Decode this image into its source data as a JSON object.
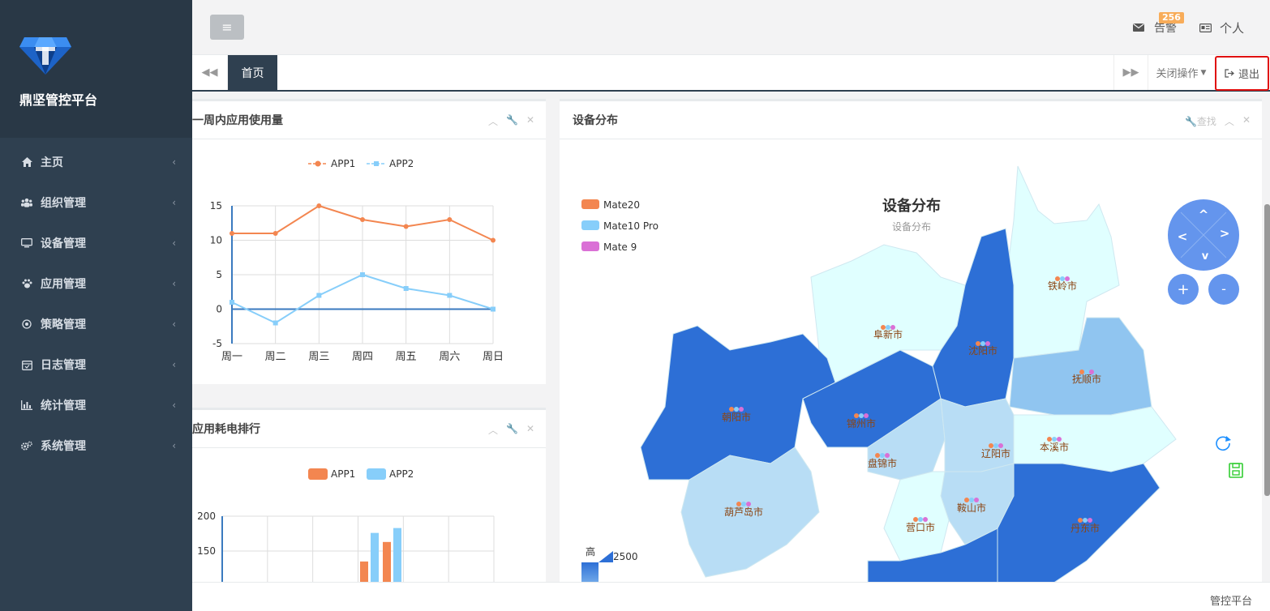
{
  "brand": {
    "name": "鼎坚管控平台"
  },
  "nav": [
    {
      "label": "主页",
      "icon": "home-icon"
    },
    {
      "label": "组织管理",
      "icon": "users-icon"
    },
    {
      "label": "设备管理",
      "icon": "monitor-icon"
    },
    {
      "label": "应用管理",
      "icon": "paw-icon"
    },
    {
      "label": "策略管理",
      "icon": "target-icon"
    },
    {
      "label": "日志管理",
      "icon": "calendar-icon"
    },
    {
      "label": "统计管理",
      "icon": "bar-chart-icon"
    },
    {
      "label": "系统管理",
      "icon": "gears-icon"
    }
  ],
  "header": {
    "alarm_label": "告警",
    "alarm_count": "256",
    "profile_label": "个人"
  },
  "tabs": {
    "home_label": "首页",
    "close_ops_label": "关闭操作",
    "logout_label": "退出"
  },
  "panels": {
    "usage_title": "一周内应用使用量",
    "power_title": "应用耗电排行",
    "device_title": "设备分布",
    "device_search": "查找"
  },
  "footer": {
    "text": "管控平台"
  },
  "colors": {
    "app1": "#f38650",
    "app2": "#87cefa",
    "accent": "#2f4050"
  },
  "chart_data": [
    {
      "type": "line",
      "legend": [
        "APP1",
        "APP2"
      ],
      "categories": [
        "周一",
        "周二",
        "周三",
        "周四",
        "周五",
        "周六",
        "周日"
      ],
      "series": [
        {
          "name": "APP1",
          "values": [
            11,
            11,
            15,
            13,
            12,
            13,
            10
          ]
        },
        {
          "name": "APP2",
          "values": [
            1,
            -2,
            2,
            5,
            3,
            2,
            0
          ]
        }
      ],
      "ylim": [
        -5,
        15
      ],
      "yticks": [
        -5,
        0,
        5,
        10,
        15
      ],
      "grid": true,
      "legend_position": "top"
    },
    {
      "type": "bar",
      "legend": [
        "APP1",
        "APP2"
      ],
      "yticks_visible": [
        150,
        200
      ],
      "series": [
        {
          "name": "APP1",
          "values": [
            135,
            163
          ]
        },
        {
          "name": "APP2",
          "values": [
            176,
            183
          ]
        }
      ],
      "grid": true,
      "legend_position": "top"
    },
    {
      "type": "map",
      "title": "设备分布",
      "subtitle": "设备分布",
      "legend": [
        "Mate20",
        "Mate10 Pro",
        "Mate 9"
      ],
      "legend_colors": [
        "#f38650",
        "#87cefa",
        "#da70d6"
      ],
      "visual_map": {
        "max_label": "高",
        "max_value": "2500"
      },
      "regions": [
        "铁岭市",
        "阜新市",
        "沈阳市",
        "抚顺市",
        "朝阳市",
        "锦州市",
        "盘锦市",
        "辽阳市",
        "本溪市",
        "葫芦岛市",
        "鞍山市",
        "营口市",
        "丹东市"
      ]
    }
  ]
}
